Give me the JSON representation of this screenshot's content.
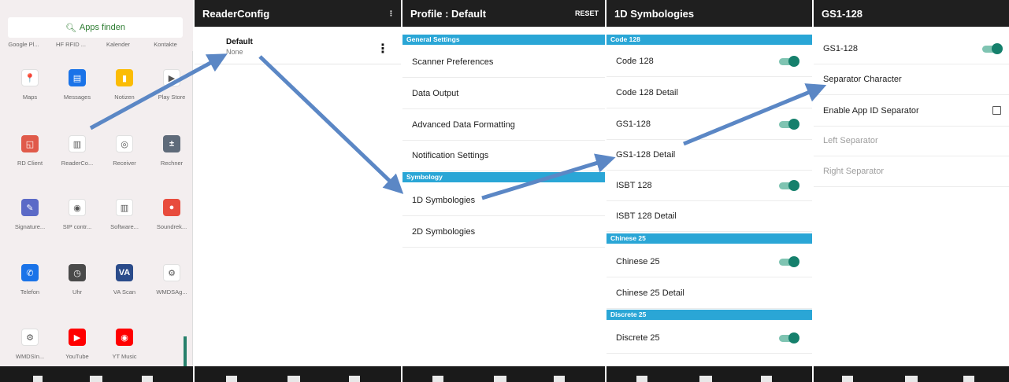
{
  "launcher": {
    "search_label": "Apps finden",
    "top_row": [
      "Google Pl...",
      "HF RFID ...",
      "Kalender",
      "Kontakte"
    ],
    "apps": [
      {
        "label": "Maps",
        "icon": "maps-icon",
        "color": "#ffffff",
        "glyph": "📍"
      },
      {
        "label": "Messages",
        "icon": "messages-icon",
        "color": "#1a73e8",
        "glyph": "▤"
      },
      {
        "label": "Notizen",
        "icon": "notes-icon",
        "color": "#fbbc04",
        "glyph": "▮"
      },
      {
        "label": "Play Store",
        "icon": "play-store-icon",
        "color": "#ffffff",
        "glyph": "▶"
      },
      {
        "label": "RD Client",
        "icon": "rd-client-icon",
        "color": "#e05a4a",
        "glyph": "◱"
      },
      {
        "label": "ReaderCo...",
        "icon": "readerconfig-icon",
        "color": "#ffffff",
        "glyph": "▥"
      },
      {
        "label": "Receiver",
        "icon": "receiver-icon",
        "color": "#ffffff",
        "glyph": "◎"
      },
      {
        "label": "Rechner",
        "icon": "calculator-icon",
        "color": "#5f6b7a",
        "glyph": "±"
      },
      {
        "label": "Signature...",
        "icon": "signature-icon",
        "color": "#5b6ac7",
        "glyph": "✎"
      },
      {
        "label": "SIP contr...",
        "icon": "sip-control-icon",
        "color": "#ffffff",
        "glyph": "◉"
      },
      {
        "label": "Software...",
        "icon": "software-icon",
        "color": "#ffffff",
        "glyph": "▥"
      },
      {
        "label": "Soundrek...",
        "icon": "sound-recorder-icon",
        "color": "#e84c3d",
        "glyph": "●"
      },
      {
        "label": "Telefon",
        "icon": "phone-icon",
        "color": "#1a73e8",
        "glyph": "✆"
      },
      {
        "label": "Uhr",
        "icon": "clock-icon",
        "color": "#4a4a4a",
        "glyph": "◷"
      },
      {
        "label": "VA Scan",
        "icon": "va-scan-icon",
        "color": "#2a4b8a",
        "glyph": "VA"
      },
      {
        "label": "WMDSAg...",
        "icon": "wmds-agent-icon",
        "color": "#ffffff",
        "glyph": "⚙"
      },
      {
        "label": "WMDSIn...",
        "icon": "wmds-installer-icon",
        "color": "#ffffff",
        "glyph": "⚙"
      },
      {
        "label": "YouTube",
        "icon": "youtube-icon",
        "color": "#ff0000",
        "glyph": "▶"
      },
      {
        "label": "YT Music",
        "icon": "yt-music-icon",
        "color": "#ff0000",
        "glyph": "◉"
      }
    ]
  },
  "readerconfig": {
    "title": "ReaderConfig",
    "menu_glyph": "⋮",
    "profile_name": "Default",
    "profile_sub": "None"
  },
  "profile": {
    "title": "Profile : Default",
    "reset_label": "RESET",
    "sections": [
      {
        "header": "General Settings",
        "items": [
          "Scanner Preferences",
          "Data Output",
          "Advanced Data Formatting",
          "Notification Settings"
        ]
      },
      {
        "header": "Symbology",
        "items": [
          "1D Symbologies",
          "2D Symbologies"
        ]
      }
    ]
  },
  "symbologies": {
    "title": "1D Symbologies",
    "sections": [
      {
        "header": "Code 128",
        "items": [
          {
            "label": "Code 128",
            "toggle": true
          },
          {
            "label": "Code 128 Detail",
            "toggle": false
          },
          {
            "label": "GS1-128",
            "toggle": true
          },
          {
            "label": "GS1-128 Detail",
            "toggle": false
          },
          {
            "label": "ISBT 128",
            "toggle": true
          },
          {
            "label": "ISBT 128 Detail",
            "toggle": false
          }
        ]
      },
      {
        "header": "Chinese 25",
        "items": [
          {
            "label": "Chinese 25",
            "toggle": true
          },
          {
            "label": "Chinese 25 Detail",
            "toggle": false
          }
        ]
      },
      {
        "header": "Discrete 25",
        "items": [
          {
            "label": "Discrete 25",
            "toggle": true
          }
        ]
      }
    ]
  },
  "gs1": {
    "title": "GS1-128",
    "items": [
      {
        "label": "GS1-128",
        "control": "toggle",
        "enabled": true
      },
      {
        "label": "Separator Character",
        "control": "none",
        "enabled": true
      },
      {
        "label": "Enable App ID Separator",
        "control": "checkbox",
        "enabled": true
      },
      {
        "label": "Left Separator",
        "control": "none",
        "enabled": false
      },
      {
        "label": "Right Separator",
        "control": "none",
        "enabled": false
      }
    ]
  },
  "colors": {
    "accent_section": "#2aa6d6",
    "toggle_on": "#15806c",
    "arrow": "#5b87c5",
    "toolbar": "#1f1f1f"
  }
}
